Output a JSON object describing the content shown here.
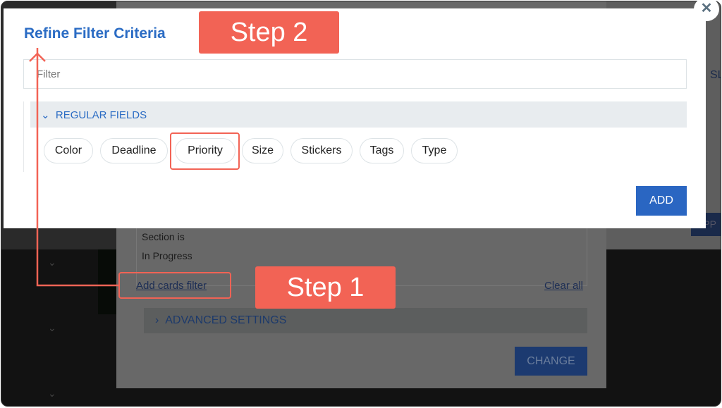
{
  "modal": {
    "title": "Refine Filter Criteria",
    "filter_placeholder": "Filter",
    "section": "REGULAR FIELDS",
    "chips": [
      "Color",
      "Deadline",
      "Priority",
      "Size",
      "Stickers",
      "Tags",
      "Type"
    ],
    "add_label": "ADD",
    "close_label": "✕"
  },
  "background": {
    "section_line1": "Section is",
    "section_line2": "In Progress",
    "add_filter": "Add cards filter",
    "clear_all": "Clear all",
    "advanced": "ADVANCED SETTINGS",
    "change": "CHANGE",
    "right_edge_1": "SL",
    "right_edge_2": "APP"
  },
  "annotations": {
    "step1": "Step 1",
    "step2": "Step 2",
    "accent": "#f26355"
  }
}
